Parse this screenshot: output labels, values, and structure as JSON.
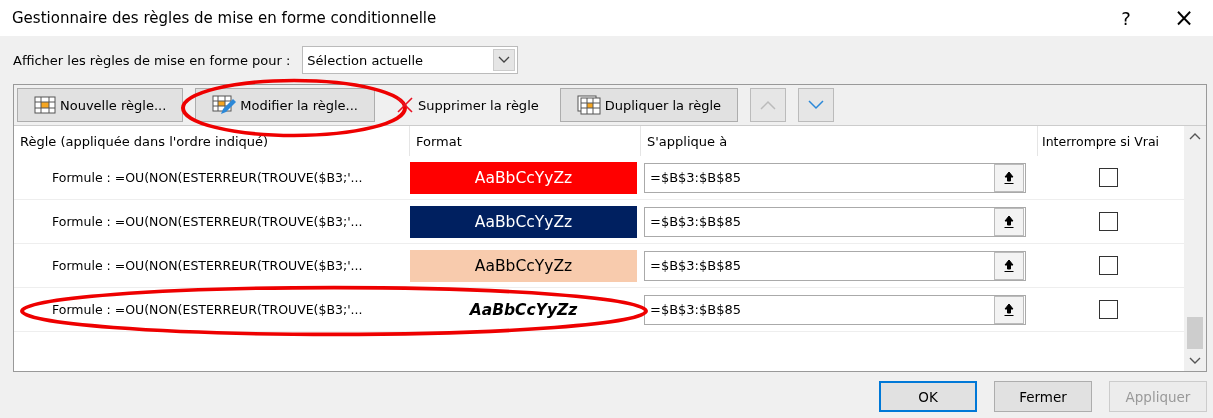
{
  "window": {
    "title": "Gestionnaire des règles de mise en forme conditionnelle",
    "help": "?",
    "close": "×"
  },
  "show_for": {
    "label": "Afficher les règles de mise en forme pour :",
    "value": "Sélection actuelle"
  },
  "toolbar": [
    {
      "kind": "new",
      "label": "Nouvelle règle...",
      "circled": false
    },
    {
      "kind": "edit",
      "label": "Modifier la règle...",
      "circled": true
    },
    {
      "kind": "delete",
      "label": "Supprimer la règle",
      "circled": false
    },
    {
      "kind": "duplicate",
      "label": "Dupliquer la règle",
      "circled": false
    }
  ],
  "move": {
    "up_disabled": true,
    "down_disabled": false
  },
  "table": {
    "columns": [
      "Règle (appliquée dans l'ordre indiqué)",
      "Format",
      "S'applique à",
      "Interrompre si Vrai"
    ],
    "rows": [
      {
        "rule": "Formule : =OU(NON(ESTERREUR(TROUVE($B3;'...",
        "sample": "AaBbCcYyZz",
        "kind": "filled",
        "color": "#ff0000",
        "applies": "=$B$3:$B$85",
        "stop": false,
        "circled": false
      },
      {
        "rule": "Formule : =OU(NON(ESTERREUR(TROUVE($B3;'...",
        "sample": "AaBbCcYyZz",
        "kind": "filled",
        "color": "#002060",
        "applies": "=$B$3:$B$85",
        "stop": false,
        "circled": false
      },
      {
        "rule": "Formule : =OU(NON(ESTERREUR(TROUVE($B3;'...",
        "sample": "AaBbCcYyZz",
        "kind": "filled",
        "color": "#f8cbad",
        "applies": "=$B$3:$B$85",
        "stop": false,
        "circled": false
      },
      {
        "rule": "Formule : =OU(NON(ESTERREUR(TROUVE($B3;'...",
        "sample": "AaBbCcYyZz",
        "kind": "bold-italic",
        "applies": "=$B$3:$B$85",
        "stop": false,
        "circled": true
      }
    ]
  },
  "buttons": [
    {
      "label": "OK",
      "kind": "default",
      "disabled": false
    },
    {
      "label": "Fermer",
      "kind": "normal",
      "disabled": false
    },
    {
      "label": "Appliquer",
      "kind": "normal",
      "disabled": true
    }
  ]
}
